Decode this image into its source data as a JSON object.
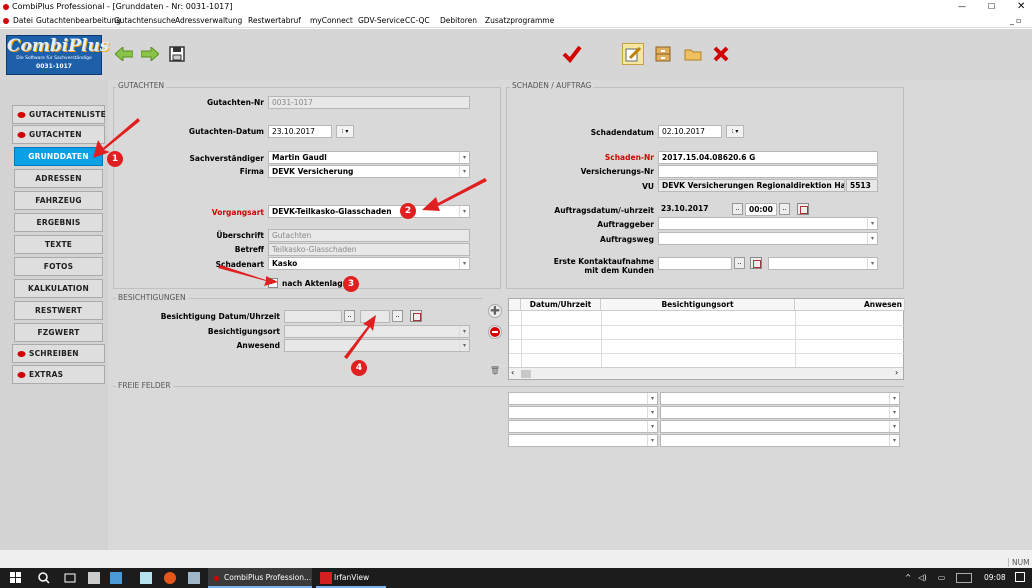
{
  "window": {
    "title": "CombiPlus Professional - [Grunddaten - Nr: 0031-1017]"
  },
  "menu": [
    "Datei",
    "Gutachtenbearbeitung",
    "Gutachtensuche",
    "Adressverwaltung",
    "Restwertabruf",
    "myConnect",
    "GDV-Service",
    "CC-QC",
    "Debitoren",
    "Zusatzprogramme"
  ],
  "logo": {
    "name": "CombiPlus",
    "tagline": "Die Software für Sachverständige",
    "case_number": "0031-1017"
  },
  "nav": [
    "GUTACHTENLISTE",
    "GUTACHTEN",
    "GRUNDDATEN",
    "ADRESSEN",
    "FAHRZEUG",
    "ERGEBNIS",
    "TEXTE",
    "FOTOS",
    "KALKULATION",
    "RESTWERT",
    "FZGWERT",
    "SCHREIBEN",
    "EXTRAS"
  ],
  "gutachten": {
    "section_title": "GUTACHTEN",
    "nr_label": "Gutachten-Nr",
    "nr_value": "0031-1017",
    "datum_label": "Gutachten-Datum",
    "datum_value": "23.10.2017",
    "sv_label": "Sachverständiger",
    "sv_value": "Martin Gaudl",
    "firma_label": "Firma",
    "firma_value": "DEVK Versicherung",
    "vorgangsart_label": "Vorgangsart",
    "vorgangsart_value": "DEVK-Teilkasko-Glasschaden",
    "ueberschrift_label": "Überschrift",
    "ueberschrift_value": "Gutachten",
    "betreff_label": "Betreff",
    "betreff_value": "Teilkasko-Glasschaden",
    "schadenart_label": "Schadenart",
    "schadenart_value": "Kasko",
    "aktenlage_label": "nach Aktenlage",
    "aktenlage_mark": "✓"
  },
  "schaden": {
    "section_title": "SCHADEN / AUFTRAG",
    "datum_label": "Schadendatum",
    "datum_value": "02.10.2017",
    "nr_label": "Schaden-Nr",
    "nr_value": "2017.15.04.08620.6 G",
    "vers_label": "Versicherungs-Nr",
    "vers_value": "",
    "vu_label": "VU",
    "vu_value": "DEVK Versicherungen Regionaldirektion Har",
    "vu_code": "5513",
    "auftrag_label": "Auftragsdatum/-uhrzeit",
    "auftrag_date": "23.10.2017",
    "auftrag_time": "00:00",
    "auftraggeber_label": "Auftraggeber",
    "auftragsweg_label": "Auftragsweg",
    "kontakt_label1": "Erste Kontaktaufnahme",
    "kontakt_label2": "mit dem Kunden"
  },
  "besichtigungen": {
    "section_title": "BESICHTIGUNGEN",
    "datum_label": "Besichtigung Datum/Uhrzeit",
    "ort_label": "Besichtigungsort",
    "anwesend_label": "Anwesend",
    "table_headers": [
      "Datum/Uhrzeit",
      "Besichtigungsort",
      "Anwesen"
    ]
  },
  "freie_felder": {
    "section_title": "FREIE FELDER"
  },
  "markers": [
    "1",
    "2",
    "3",
    "4"
  ],
  "status": {
    "num": "NUM"
  },
  "taskbar": {
    "app1": "CombiPlus Profession...",
    "app2": "IrfanView",
    "time": "09:08"
  },
  "colors": {
    "accent": "#0aa0e6",
    "red": "#d40000",
    "marker": "#e02020"
  }
}
